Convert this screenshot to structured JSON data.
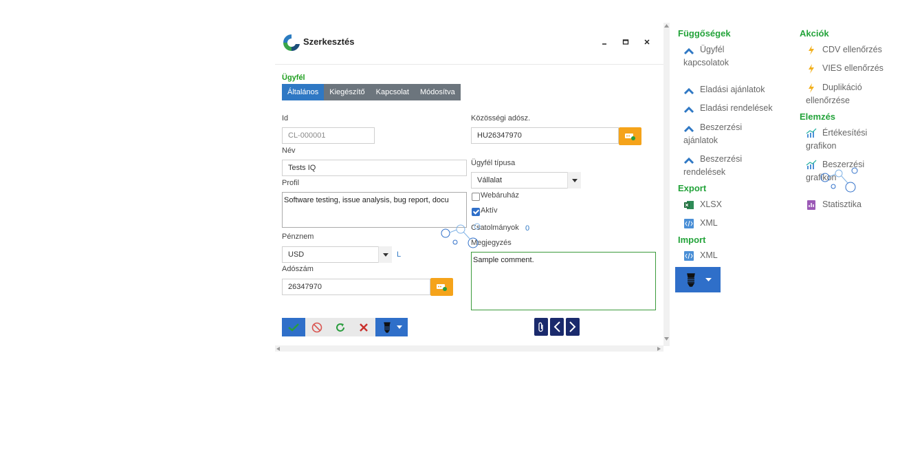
{
  "dialog": {
    "title": "Szerkesztés",
    "section": "Ügyfél",
    "tabs": [
      "Általános",
      "Kiegészítő",
      "Kapcsolat",
      "Módosítva"
    ],
    "fields": {
      "id_label": "Id",
      "id_placeholder": "CL-000001",
      "name_label": "Név",
      "name_value": "Tests IQ",
      "profile_label": "Profil",
      "profile_value": "Software testing, issue analysis, bug report, docu",
      "currency_label": "Pénznem",
      "currency_value": "USD",
      "currency_link": "L",
      "tax_label": "Adószám",
      "tax_value": "26347970",
      "eu_tax_label": "Közösségi adósz.",
      "eu_tax_value": "HU26347970",
      "client_type_label": "Ügyfél típusa",
      "client_type_value": "Vállalat",
      "webshop_label": "Webáruház",
      "webshop_checked": false,
      "active_label": "Aktív",
      "active_checked": true,
      "attachments_label": "Csatolmányok",
      "attachments_count": "0",
      "comment_label": "Megjegyzés",
      "comment_value": "Sample comment."
    }
  },
  "panel": {
    "dependencies": {
      "title": "Függőségek",
      "items": [
        {
          "line1": "Ügyfél",
          "line2": "kapcsolatok",
          "icon": "chevron-up-icon"
        },
        {
          "line1": "Eladási ajánlatok",
          "line2": "",
          "icon": "chevron-up-icon"
        },
        {
          "line1": "Eladási rendelések",
          "line2": "",
          "icon": "chevron-up-icon"
        },
        {
          "line1": "Beszerzési",
          "line2": "ajánlatok",
          "icon": "chevron-up-icon"
        },
        {
          "line1": "Beszerzési",
          "line2": "rendelések",
          "icon": "chevron-up-icon"
        }
      ]
    },
    "export": {
      "title": "Export",
      "items": [
        {
          "label": "XLSX",
          "icon": "excel-icon"
        },
        {
          "label": "XML",
          "icon": "xml-icon"
        }
      ]
    },
    "import": {
      "title": "Import",
      "items": [
        {
          "label": "XML",
          "icon": "xml-icon"
        }
      ]
    },
    "actions": {
      "title": "Akciók",
      "items": [
        {
          "line1": "CDV ellenőrzés",
          "line2": "",
          "icon": "lightning-icon"
        },
        {
          "line1": "VIES ellenőrzés",
          "line2": "",
          "icon": "lightning-icon"
        },
        {
          "line1": "Duplikáció",
          "line2": "ellenőrzése",
          "icon": "lightning-icon"
        }
      ]
    },
    "analysis": {
      "title": "Elemzés",
      "items": [
        {
          "line1": "Értékesítési",
          "line2": "grafikon",
          "icon": "chart-icon"
        },
        {
          "line1": "Beszerzési",
          "line2": "grafikon",
          "icon": "chart-icon"
        },
        {
          "line1": "Statisztika",
          "line2": "",
          "icon": "stats-icon"
        }
      ]
    }
  },
  "colors": {
    "accent": "#2f78c4",
    "section_green": "#23a33a",
    "tab_gray": "#6c757d",
    "orange": "#f5a31a",
    "navy": "#1a2a6c"
  }
}
